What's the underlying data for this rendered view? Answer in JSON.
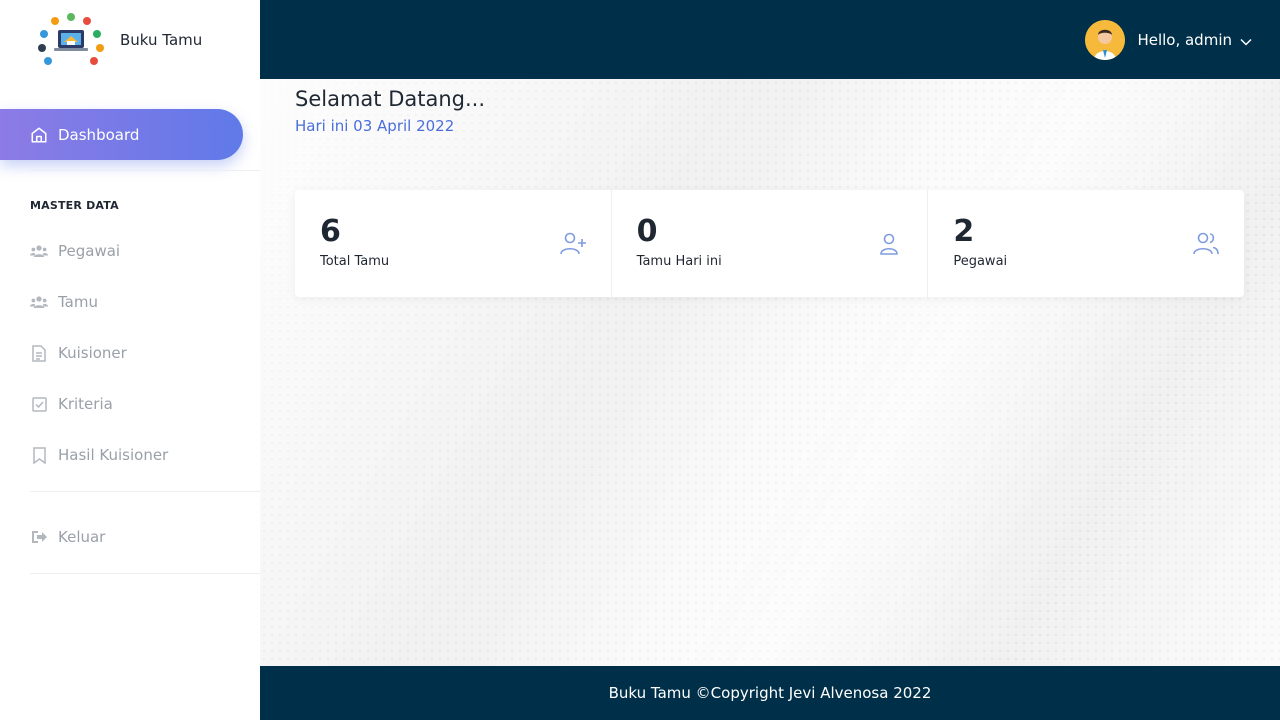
{
  "brand": {
    "title": "Buku Tamu"
  },
  "sidebar": {
    "active": {
      "label": "Dashboard",
      "icon": "home-icon"
    },
    "section_title": "MASTER DATA",
    "items": [
      {
        "label": "Pegawai",
        "icon": "users-icon"
      },
      {
        "label": "Tamu",
        "icon": "users-icon"
      },
      {
        "label": "Kuisioner",
        "icon": "document-icon"
      },
      {
        "label": "Kriteria",
        "icon": "check-square-icon"
      },
      {
        "label": "Hasil Kuisioner",
        "icon": "bookmark-icon"
      }
    ],
    "logout": {
      "label": "Keluar",
      "icon": "logout-icon"
    }
  },
  "header": {
    "greeting": "Hello, admin"
  },
  "main": {
    "welcome": "Selamat Datang...",
    "date": "Hari ini 03 April 2022",
    "stats": [
      {
        "value": "6",
        "label": "Total Tamu",
        "icon": "user-plus-icon"
      },
      {
        "value": "0",
        "label": "Tamu Hari ini",
        "icon": "user-icon"
      },
      {
        "value": "2",
        "label": "Pegawai",
        "icon": "users-icon"
      }
    ]
  },
  "footer": {
    "text": "Buku Tamu ©Copyright Jevi Alvenosa 2022"
  },
  "colors": {
    "header": "#003049",
    "accent": "#5f7ae8",
    "accent_start": "#8d7be6",
    "date_text": "#4c6edb"
  }
}
